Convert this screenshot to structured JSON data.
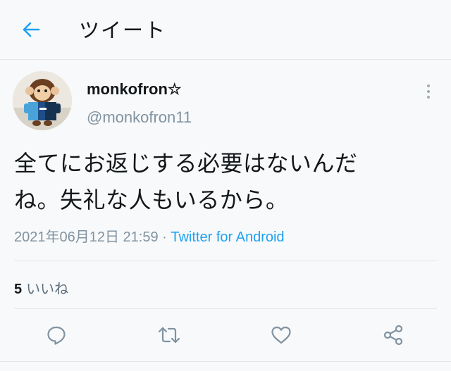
{
  "header": {
    "back_icon": "arrow-left-icon",
    "title": "ツイート"
  },
  "tweet": {
    "display_name": "monkofron☆",
    "handle": "@monkofron11",
    "text_line1": "全てにお返じする必要はないんだ",
    "text_line2": "ね。失礼な人もいるから。",
    "timestamp": "2021年06月12日 21:59",
    "separator": " · ",
    "source": "Twitter for Android",
    "likes_count": "5",
    "likes_label": "いいね"
  },
  "actions": [
    "reply-icon",
    "retweet-icon",
    "like-icon",
    "share-icon"
  ],
  "colors": {
    "accent": "#1da1f2",
    "secondary_text": "#8192a0",
    "background": "#f7f9fa"
  }
}
